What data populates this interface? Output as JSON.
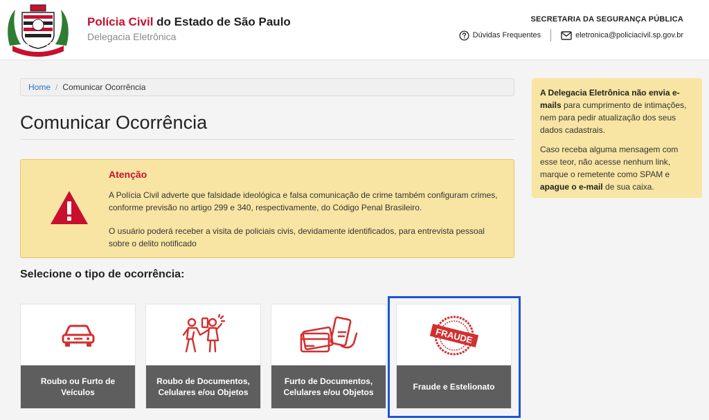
{
  "header": {
    "brand_red": "Polícia Civil",
    "brand_rest": " do Estado de São Paulo",
    "subtitle": "Delegacia Eletrônica",
    "ssp": "SECRETARIA DA SEGURANÇA PÚBLICA",
    "faq_label": "Dúvidas Frequentes",
    "email_label": "eletronica@policiacivil.sp.gov.br",
    "logo_text": "SÃO PAULO",
    "icons": {
      "faq": "question-circle-icon",
      "email": "envelope-icon"
    }
  },
  "breadcrumb": {
    "home": "Home",
    "separator": "/",
    "current": "Comunicar Ocorrência"
  },
  "page_title": "Comunicar Ocorrência",
  "alert": {
    "title": "Atenção",
    "p1": "A Polícia Civil adverte que falsidade ideológica e falsa comunicação de crime também configuram crimes, conforme previsão no artigo 299 e 340, respectivamente, do Código Penal Brasileiro.",
    "p2": "O usuário poderá receber a visita de policiais civis, devidamente identificados, para entrevista pessoal sobre o delito notificado",
    "icon": "warning-triangle-icon"
  },
  "select_title": "Selecione o tipo de ocorrência:",
  "cards": [
    {
      "label": "Roubo ou Furto de Veículos",
      "icon": "car-icon"
    },
    {
      "label": "Roubo de Documentos, Celulares e/ou Objetos",
      "icon": "robbery-icon"
    },
    {
      "label": "Furto de Documentos, Celulares e/ou Objetos",
      "icon": "cards-phone-icon"
    },
    {
      "label": "Fraude e Estelionato",
      "icon": "fraude-stamp-icon",
      "stamp_text": "FRAUDE",
      "selected": true
    }
  ],
  "side": {
    "bold1": "A Delegacia Eletrônica não envia e-mails",
    "text1": " para cumprimento de intimações, nem para pedir atualização dos seus dados cadastrais.",
    "text2": "Caso receba alguma mensagem com esse teor, não acesse nenhum link, marque o remetente como SPAM e ",
    "bold2": "apague o e-mail",
    "text3": " de sua caixa."
  },
  "colors": {
    "red": "#c8102e",
    "alert_bg": "#f8e5a3",
    "card_label_bg": "#5e5e5e",
    "selection": "#1a56d6",
    "link": "#2a6ebf"
  }
}
